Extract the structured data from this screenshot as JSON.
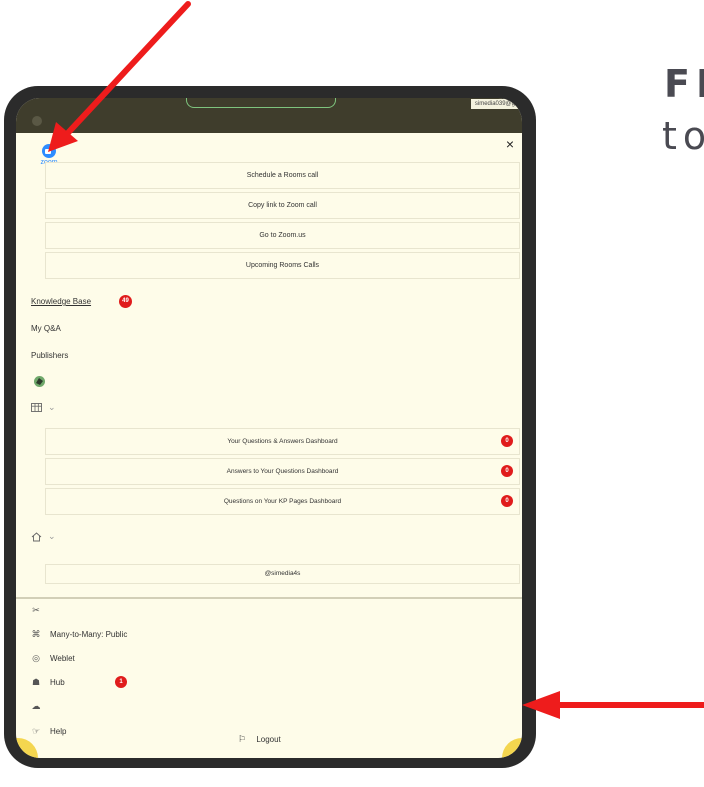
{
  "heading": {
    "line1": "FI",
    "line2": "to"
  },
  "topbar": {
    "email": "simedia039@gm"
  },
  "close": "×",
  "zoom": {
    "logo_text": "zoom"
  },
  "zoom_menu": [
    {
      "label": "Schedule a Rooms call"
    },
    {
      "label": "Copy link to Zoom call"
    },
    {
      "label": "Go to Zoom.us"
    },
    {
      "label": "Upcoming Rooms Calls"
    }
  ],
  "sidebar": {
    "knowledge_base": "Knowledge Base",
    "knowledge_base_badge": "49",
    "my_qa": "My Q&A",
    "publishers": "Publishers",
    "expand_icon": "⌄"
  },
  "dashboards": [
    {
      "label": "Your Questions & Answers Dashboard",
      "badge": "0"
    },
    {
      "label": "Answers to Your Questions Dashboard",
      "badge": "0"
    },
    {
      "label": "Questions on Your KP Pages Dashboard",
      "badge": "0"
    }
  ],
  "handle_button": "@simedia4s",
  "footer": {
    "many_to_many": "Many-to-Many: Public",
    "weblet": "Weblet",
    "hub": "Hub",
    "hub_badge": "1",
    "help": "Help",
    "logout": "Logout"
  },
  "colors": {
    "screen_bg": "#fefce9",
    "topbar": "#3f3d2c",
    "badge": "#e01c1c",
    "zoom_blue": "#2d8cff",
    "arrow": "#ee1c1c"
  }
}
